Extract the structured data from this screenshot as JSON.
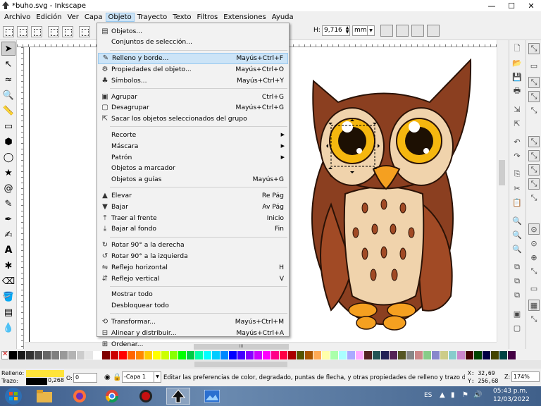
{
  "window": {
    "title": "*buho.svg - Inkscape",
    "minimize": "—",
    "maximize": "☐"
  },
  "menubar": [
    "Archivo",
    "Edición",
    "Ver",
    "Capa",
    "Objeto",
    "Trayecto",
    "Texto",
    "Filtros",
    "Extensiones",
    "Ayuda"
  ],
  "controls": {
    "h_label": "H:",
    "h_value": "9,716",
    "unit": "mm"
  },
  "object_menu": [
    {
      "label": "Objetos...",
      "shortcut": "",
      "icon": "objects-icon"
    },
    {
      "label": "Conjuntos de selección...",
      "shortcut": "",
      "icon": ""
    },
    {
      "sep": true
    },
    {
      "label": "Relleno y borde...",
      "shortcut": "Mayús+Ctrl+F",
      "icon": "fill-stroke-icon",
      "highlight": true
    },
    {
      "label": "Propiedades del objeto...",
      "shortcut": "Mayús+Ctrl+O",
      "icon": "object-properties-icon"
    },
    {
      "label": "Símbolos...",
      "shortcut": "Mayús+Ctrl+Y",
      "icon": "symbols-icon"
    },
    {
      "sep": true
    },
    {
      "label": "Agrupar",
      "shortcut": "Ctrl+G",
      "icon": "group-icon"
    },
    {
      "label": "Desagrupar",
      "shortcut": "Mayús+Ctrl+G",
      "icon": "ungroup-icon"
    },
    {
      "label": "Sacar los objetos seleccionados del grupo",
      "shortcut": "",
      "icon": "pop-from-group-icon"
    },
    {
      "sep": true
    },
    {
      "label": "Recorte",
      "shortcut": "",
      "icon": "",
      "submenu": true
    },
    {
      "label": "Máscara",
      "shortcut": "",
      "icon": "",
      "submenu": true
    },
    {
      "label": "Patrón",
      "shortcut": "",
      "icon": "",
      "submenu": true
    },
    {
      "label": "Objetos a marcador",
      "shortcut": "",
      "icon": ""
    },
    {
      "label": "Objetos a guías",
      "shortcut": "Mayús+G",
      "icon": ""
    },
    {
      "sep": true
    },
    {
      "label": "Elevar",
      "shortcut": "Re Pág",
      "icon": "raise-icon"
    },
    {
      "label": "Bajar",
      "shortcut": "Av Pág",
      "icon": "lower-icon"
    },
    {
      "label": "Traer al frente",
      "shortcut": "Inicio",
      "icon": "raise-to-top-icon"
    },
    {
      "label": "Bajar al fondo",
      "shortcut": "Fin",
      "icon": "lower-to-bottom-icon"
    },
    {
      "sep": true
    },
    {
      "label": "Rotar 90° a la derecha",
      "shortcut": "",
      "icon": "rotate-cw-icon"
    },
    {
      "label": "Rotar 90° a la izquierda",
      "shortcut": "",
      "icon": "rotate-ccw-icon"
    },
    {
      "label": "Reflejo horizontal",
      "shortcut": "H",
      "icon": "flip-horizontal-icon"
    },
    {
      "label": "Reflejo vertical",
      "shortcut": "V",
      "icon": "flip-vertical-icon"
    },
    {
      "sep": true
    },
    {
      "label": "Mostrar todo",
      "shortcut": "",
      "icon": ""
    },
    {
      "label": "Desbloquear todo",
      "shortcut": "",
      "icon": ""
    },
    {
      "sep": true
    },
    {
      "label": "Transformar...",
      "shortcut": "Mayús+Ctrl+M",
      "icon": "transform-icon"
    },
    {
      "label": "Alinear y distribuir...",
      "shortcut": "Mayús+Ctrl+A",
      "icon": "align-icon"
    },
    {
      "label": "Ordenar...",
      "shortcut": "",
      "icon": "arrange-icon"
    }
  ],
  "status": {
    "fill_label": "Relleno:",
    "stroke_label": "Trazo:",
    "stroke_width": "0,268",
    "opacity_label": "O:",
    "opacity_value": "0",
    "layer": "-Capa 1",
    "message": "Editar las preferencias de color, degradado, puntas de flecha, y otras propiedades de relleno y trazo de un o...",
    "x_label": "X:",
    "x_value": "32,69",
    "y_label": "Y:",
    "y_value": "256,68",
    "zoom_label": "Z:",
    "zoom_value": "174%"
  },
  "taskbar": {
    "lang": "ES",
    "time": "05:43 p.m.",
    "date": "12/03/2022"
  },
  "colors": {
    "fill": "#ffe43a",
    "stroke": "#000000",
    "menu_highlight": "#cce4f7"
  }
}
